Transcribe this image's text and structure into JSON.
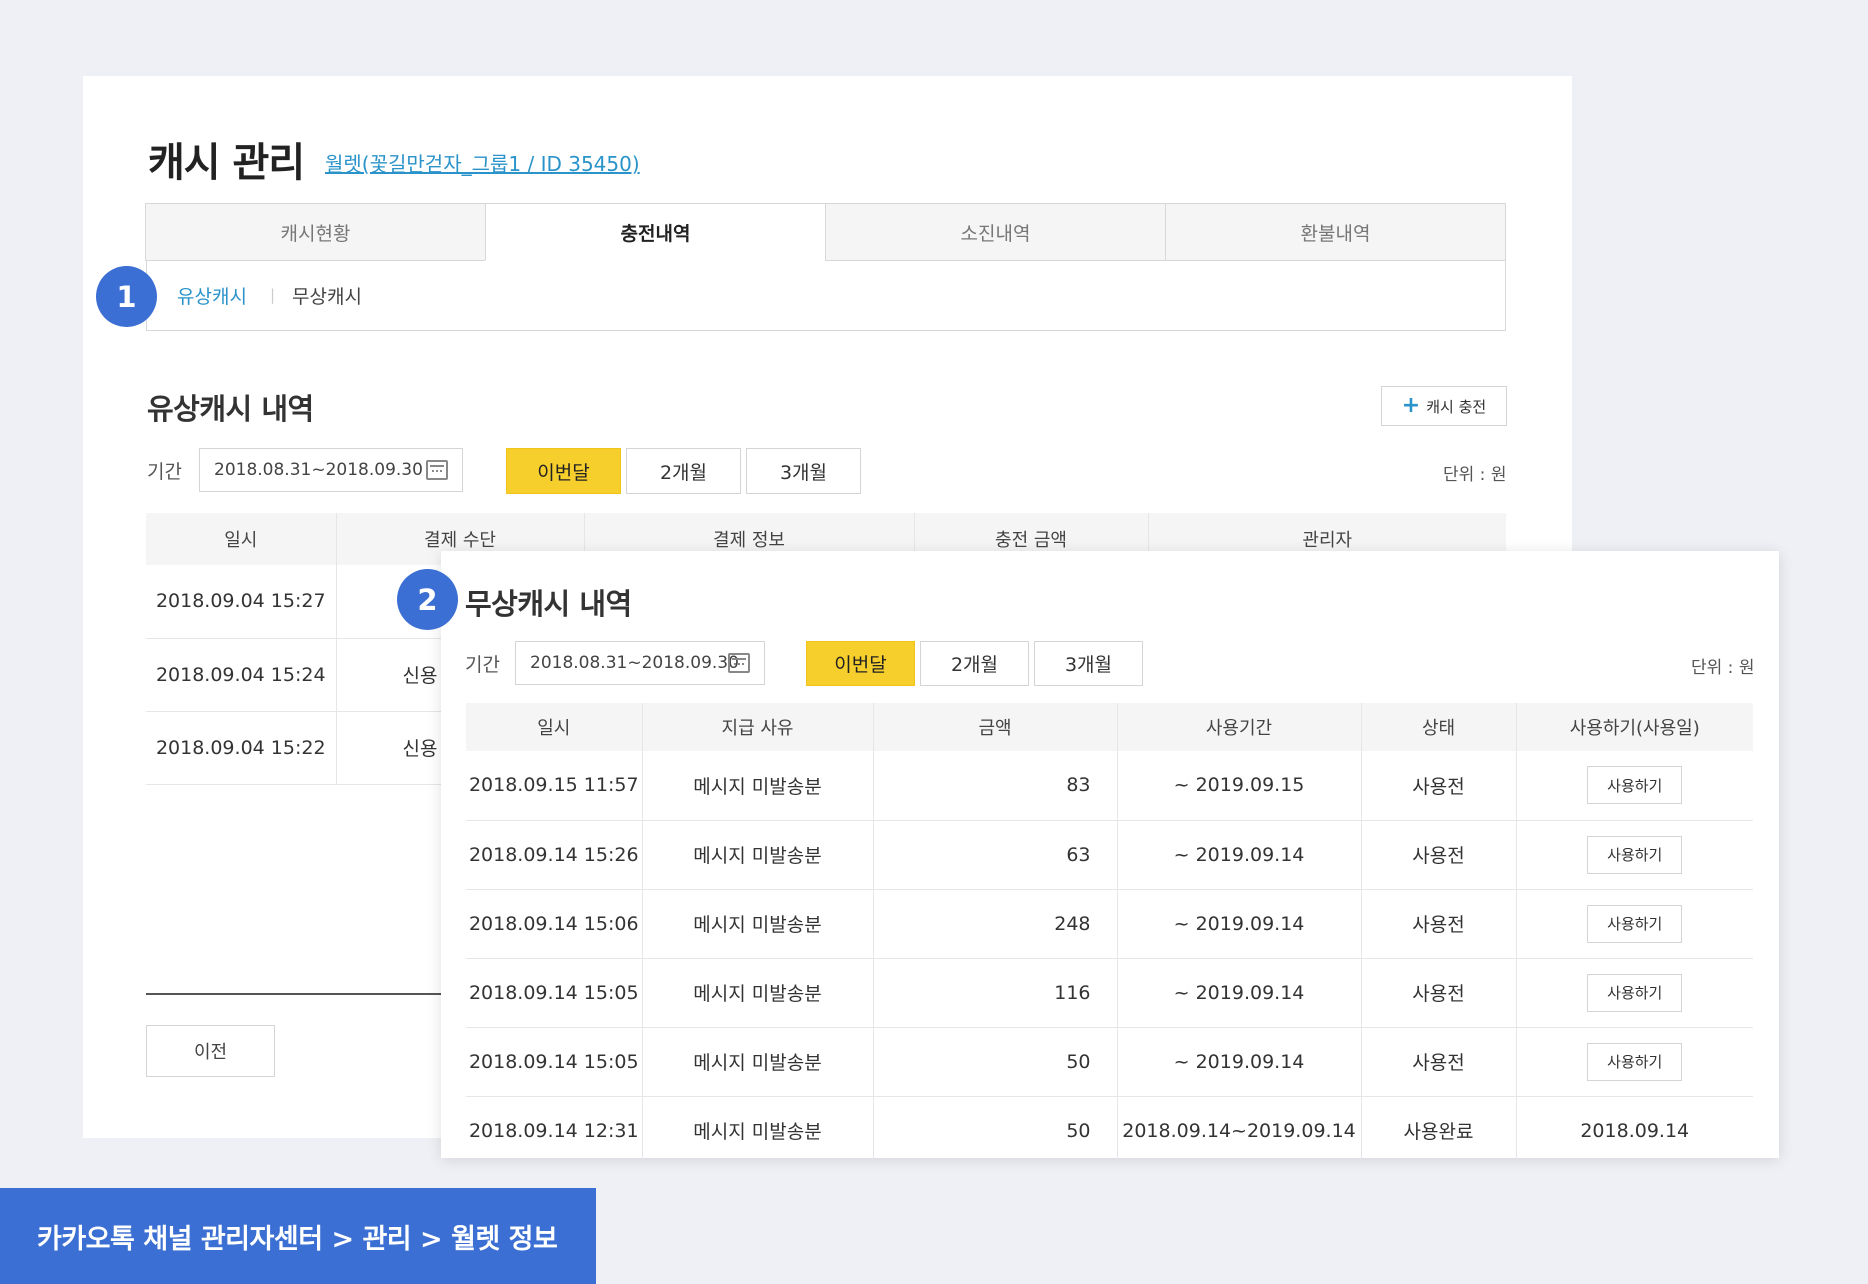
{
  "header": {
    "title": "캐시 관리",
    "wallet_link": "월렛(꽃길만걷자_그룹1 / ID 35450)"
  },
  "tabs": [
    {
      "label": "캐시현황",
      "active": false
    },
    {
      "label": "충전내역",
      "active": true
    },
    {
      "label": "소진내역",
      "active": false
    },
    {
      "label": "환불내역",
      "active": false
    }
  ],
  "subtabs": {
    "paid": "유상캐시",
    "separator": "|",
    "free": "무상캐시"
  },
  "markers": {
    "one": "1",
    "two": "2"
  },
  "paid_section": {
    "title": "유상캐시 내역",
    "charge_button": "캐시 충전",
    "period_label": "기간",
    "date_range": "2018.08.31~2018.09.30",
    "period_buttons": [
      "이번달",
      "2개월",
      "3개월"
    ],
    "unit": "단위 : 원",
    "columns": [
      "일시",
      "결제 수단",
      "결제 정보",
      "충전 금액",
      "관리자"
    ],
    "rows": [
      {
        "datetime": "2018.09.04 15:27",
        "method": ""
      },
      {
        "datetime": "2018.09.04 15:24",
        "method": "신용"
      },
      {
        "datetime": "2018.09.04 15:22",
        "method": "신용"
      }
    ],
    "prev_button": "이전"
  },
  "free_section": {
    "title": "무상캐시 내역",
    "period_label": "기간",
    "date_range": "2018.08.31~2018.09.30",
    "period_buttons": [
      "이번달",
      "2개월",
      "3개월"
    ],
    "unit": "단위 : 원",
    "columns": [
      "일시",
      "지급 사유",
      "금액",
      "사용기간",
      "상태",
      "사용하기(사용일)"
    ],
    "rows": [
      {
        "datetime": "2018.09.15 11:57",
        "reason": "메시지 미발송분",
        "amount": "83",
        "period": "~ 2019.09.15",
        "status": "사용전",
        "action": "사용하기",
        "action_is_button": true
      },
      {
        "datetime": "2018.09.14 15:26",
        "reason": "메시지 미발송분",
        "amount": "63",
        "period": "~ 2019.09.14",
        "status": "사용전",
        "action": "사용하기",
        "action_is_button": true
      },
      {
        "datetime": "2018.09.14 15:06",
        "reason": "메시지 미발송분",
        "amount": "248",
        "period": "~ 2019.09.14",
        "status": "사용전",
        "action": "사용하기",
        "action_is_button": true
      },
      {
        "datetime": "2018.09.14 15:05",
        "reason": "메시지 미발송분",
        "amount": "116",
        "period": "~ 2019.09.14",
        "status": "사용전",
        "action": "사용하기",
        "action_is_button": true
      },
      {
        "datetime": "2018.09.14 15:05",
        "reason": "메시지 미발송분",
        "amount": "50",
        "period": "~ 2019.09.14",
        "status": "사용전",
        "action": "사용하기",
        "action_is_button": true
      },
      {
        "datetime": "2018.09.14 12:31",
        "reason": "메시지 미발송분",
        "amount": "50",
        "period": "2018.09.14~2019.09.14",
        "status": "사용완료",
        "action": "2018.09.14",
        "action_is_button": false
      }
    ]
  },
  "breadcrumb": "카카오톡 채널 관리자센터 > 관리 > 월렛 정보",
  "colors": {
    "accent_blue": "#3b6fd3",
    "link_blue": "#2a93c9",
    "active_yellow": "#f7cf2c",
    "background": "#eef0f5"
  }
}
